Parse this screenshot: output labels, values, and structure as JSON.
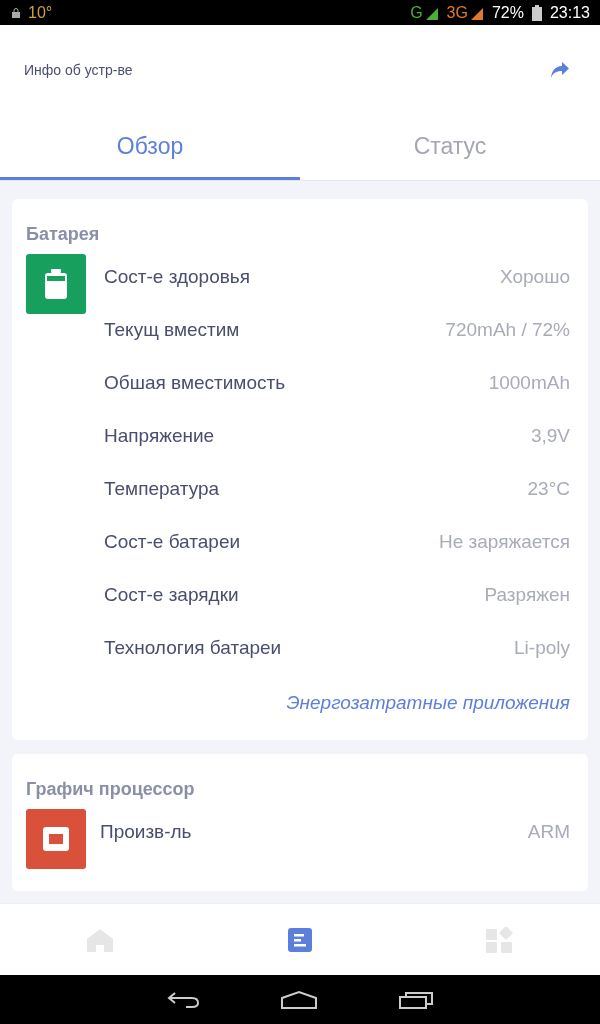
{
  "status_bar": {
    "temperature": "10°",
    "networks": [
      {
        "label": "G",
        "kind": "g"
      },
      {
        "label": "3G",
        "kind": "umts"
      }
    ],
    "battery": "72%",
    "time": "23:13"
  },
  "header": {
    "title": "Инфо об устр-ве"
  },
  "tabs": [
    {
      "label": "Обзор",
      "selected": true
    },
    {
      "label": "Статус",
      "selected": false
    }
  ],
  "sections": [
    {
      "title": "Батарея",
      "kind": "battery",
      "color": "#17a05d",
      "rows": [
        {
          "label": "Сост-е здоровья",
          "value": "Хорошо"
        },
        {
          "label": "Текущ вместим",
          "value": "720mAh / 72%"
        },
        {
          "label": "Обшая вместимость",
          "value": "1000mAh"
        },
        {
          "label": "Напряжение",
          "value": "3,9V"
        },
        {
          "label": "Температура",
          "value": "23°C"
        },
        {
          "label": "Сост-е батареи",
          "value": "Не заряжается"
        },
        {
          "label": "Сост-е зарядки",
          "value": "Разряжен"
        },
        {
          "label": "Технология батареи",
          "value": "Li-poly"
        }
      ],
      "link": "Энергозатратные приложения"
    },
    {
      "title": "Графич процессор",
      "kind": "chip",
      "color": "#d9503b",
      "rows": [
        {
          "label": "Произв-ль",
          "value": "ARM"
        }
      ]
    }
  ],
  "bottom_nav": [
    {
      "kind": "home",
      "selected": false
    },
    {
      "kind": "overview",
      "selected": true
    },
    {
      "kind": "apps",
      "selected": false
    }
  ]
}
